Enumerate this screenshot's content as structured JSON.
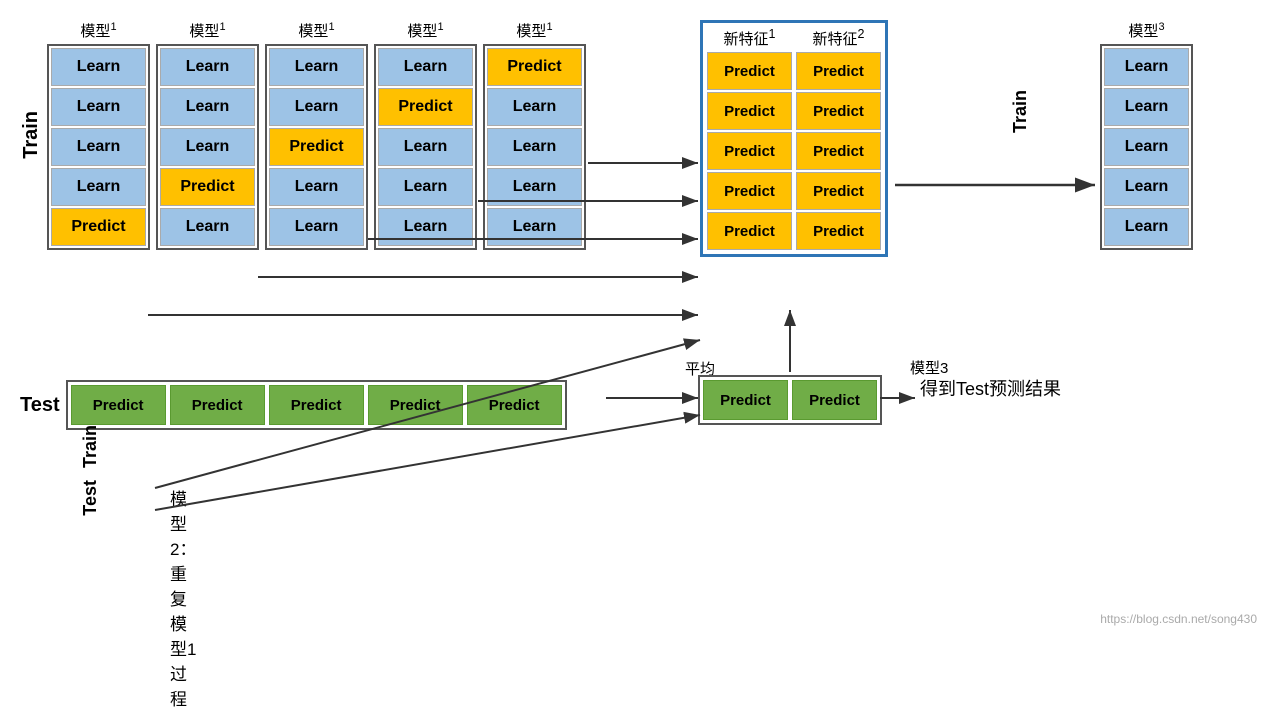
{
  "train_label": "Train",
  "test_label": "Test",
  "models": [
    {
      "title": "模型",
      "sup": "1",
      "cells": [
        "Learn",
        "Learn",
        "Learn",
        "Learn",
        "Predict"
      ]
    },
    {
      "title": "模型",
      "sup": "1",
      "cells": [
        "Learn",
        "Learn",
        "Learn",
        "Predict",
        "Learn"
      ]
    },
    {
      "title": "模型",
      "sup": "1",
      "cells": [
        "Learn",
        "Learn",
        "Predict",
        "Learn",
        "Learn"
      ]
    },
    {
      "title": "模型",
      "sup": "1",
      "cells": [
        "Learn",
        "Predict",
        "Learn",
        "Learn",
        "Learn"
      ]
    },
    {
      "title": "模型",
      "sup": "1",
      "cells": [
        "Predict",
        "Learn",
        "Learn",
        "Learn",
        "Learn"
      ]
    }
  ],
  "new_feature1_title": "新特征",
  "new_feature1_sup": "1",
  "new_feature2_title": "新特征",
  "new_feature2_sup": "2",
  "new_features_cells": [
    "Predict",
    "Predict",
    "Predict",
    "Predict",
    "Predict"
  ],
  "model3_title": "模型",
  "model3_sup": "3",
  "model3_cells": [
    "Learn",
    "Learn",
    "Learn",
    "Learn",
    "Learn"
  ],
  "train_arrow_text": "Train",
  "test_cells": [
    "Predict",
    "Predict",
    "Predict",
    "Predict",
    "Predict"
  ],
  "test_new_cells": [
    "Predict",
    "Predict"
  ],
  "avg_label": "平均",
  "model3_result_label": "模型3",
  "result_text": "得到Test预测结果",
  "bottom_note_title": "模型2：重复模型1过程",
  "train_bottom": "Train",
  "test_bottom": "Test",
  "watermark": "https://blog.csdn.net/song430"
}
